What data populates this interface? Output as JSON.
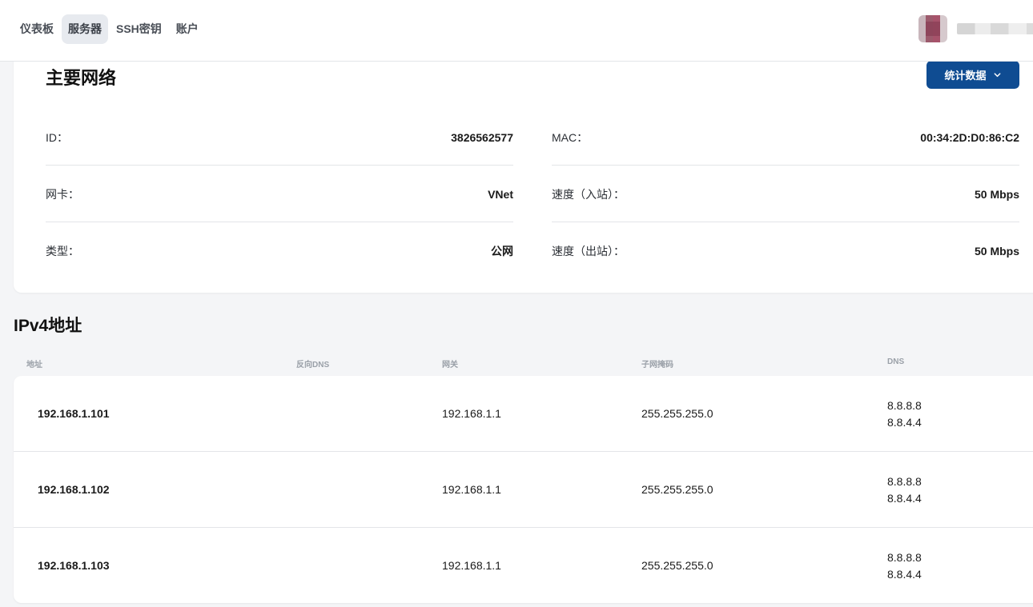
{
  "nav": {
    "items": [
      "仪表板",
      "服务器",
      "SSH密钥",
      "账户"
    ],
    "active_index": 1
  },
  "network": {
    "title": "主要网络",
    "stats_button": "统计数据",
    "left": [
      {
        "label": "ID：",
        "value": "3826562577"
      },
      {
        "label": "网卡：",
        "value": "VNet"
      },
      {
        "label": "类型：",
        "value": "公网"
      }
    ],
    "right": [
      {
        "label": "MAC：",
        "value": "00:34:2D:D0:86:C2"
      },
      {
        "label": "速度（入站）：",
        "value": "50 Mbps"
      },
      {
        "label": "速度（出站）：",
        "value": "50 Mbps"
      }
    ]
  },
  "ipv4": {
    "title": "IPv4地址",
    "columns": [
      "地址",
      "反向DNS",
      "网关",
      "子网掩码",
      "DNS"
    ],
    "rows": [
      {
        "address": "192.168.1.101",
        "reverse_dns": "",
        "gateway": "192.168.1.1",
        "netmask": "255.255.255.0",
        "dns": [
          "8.8.8.8",
          "8.8.4.4"
        ]
      },
      {
        "address": "192.168.1.102",
        "reverse_dns": "",
        "gateway": "192.168.1.1",
        "netmask": "255.255.255.0",
        "dns": [
          "8.8.8.8",
          "8.8.4.4"
        ]
      },
      {
        "address": "192.168.1.103",
        "reverse_dns": "",
        "gateway": "192.168.1.1",
        "netmask": "255.255.255.0",
        "dns": [
          "8.8.8.8",
          "8.8.4.4"
        ]
      }
    ]
  },
  "colors": {
    "primary_button": "#0f4c92",
    "page_bg": "#f4f5f7"
  },
  "icons": {
    "stats_button": "chevron-down-icon"
  }
}
